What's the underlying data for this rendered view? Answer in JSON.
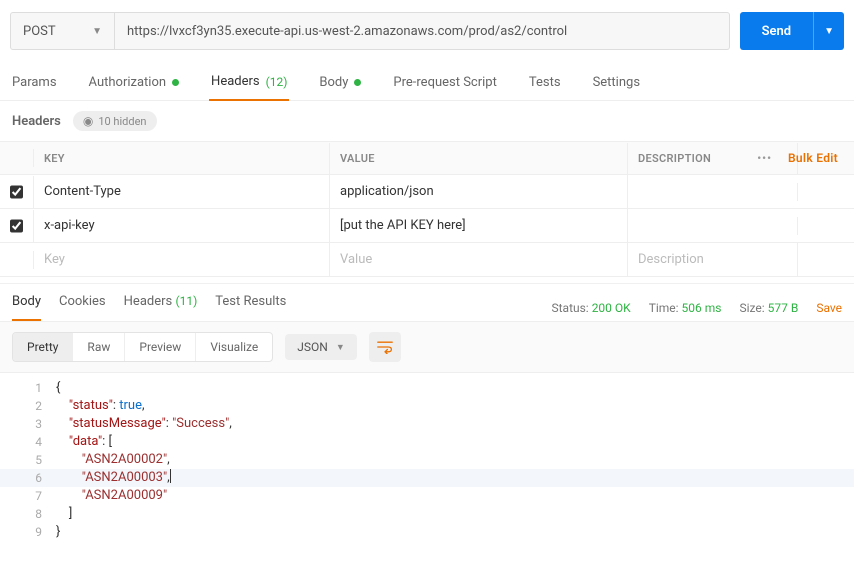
{
  "request": {
    "method": "POST",
    "url": "https://lvxcf3yn35.execute-api.us-west-2.amazonaws.com/prod/as2/control",
    "sendLabel": "Send"
  },
  "requestTabs": {
    "params": "Params",
    "authorization": "Authorization",
    "headers": "Headers",
    "headersCount": "(12)",
    "body": "Body",
    "preRequest": "Pre-request Script",
    "tests": "Tests",
    "settings": "Settings"
  },
  "headersSection": {
    "title": "Headers",
    "hiddenLabel": "10 hidden",
    "columns": {
      "key": "KEY",
      "value": "VALUE",
      "description": "DESCRIPTION"
    },
    "bulkEdit": "Bulk Edit",
    "rows": [
      {
        "checked": true,
        "key": "Content-Type",
        "value": "application/json",
        "description": ""
      },
      {
        "checked": true,
        "key": "x-api-key",
        "value": "[put the API KEY here]",
        "description": ""
      }
    ],
    "placeholders": {
      "key": "Key",
      "value": "Value",
      "description": "Description"
    }
  },
  "responseTabs": {
    "body": "Body",
    "cookies": "Cookies",
    "headers": "Headers",
    "headersCount": "(11)",
    "testResults": "Test Results"
  },
  "responseMeta": {
    "statusLabel": "Status:",
    "statusValue": "200 OK",
    "timeLabel": "Time:",
    "timeValue": "506 ms",
    "sizeLabel": "Size:",
    "sizeValue": "577 B",
    "save": "Save"
  },
  "viewTabs": {
    "pretty": "Pretty",
    "raw": "Raw",
    "preview": "Preview",
    "visualize": "Visualize",
    "format": "JSON"
  },
  "responseBody": {
    "lines": [
      {
        "n": 1,
        "html": "{"
      },
      {
        "n": 2,
        "html": "    <span class='key'>\"status\"</span>: <span class='kw'>true</span>,"
      },
      {
        "n": 3,
        "html": "    <span class='key'>\"statusMessage\"</span>: <span class='str'>\"Success\"</span>,"
      },
      {
        "n": 4,
        "html": "    <span class='key'>\"data\"</span>: ["
      },
      {
        "n": 5,
        "html": "        <span class='str'>\"ASN2A00002\"</span>,"
      },
      {
        "n": 6,
        "html": "        <span class='str'>\"ASN2A00003\"</span>,<span class='cursor'></span>",
        "hl": true
      },
      {
        "n": 7,
        "html": "        <span class='str'>\"ASN2A00009\"</span>"
      },
      {
        "n": 8,
        "html": "    ]"
      },
      {
        "n": 9,
        "html": "}"
      }
    ]
  }
}
